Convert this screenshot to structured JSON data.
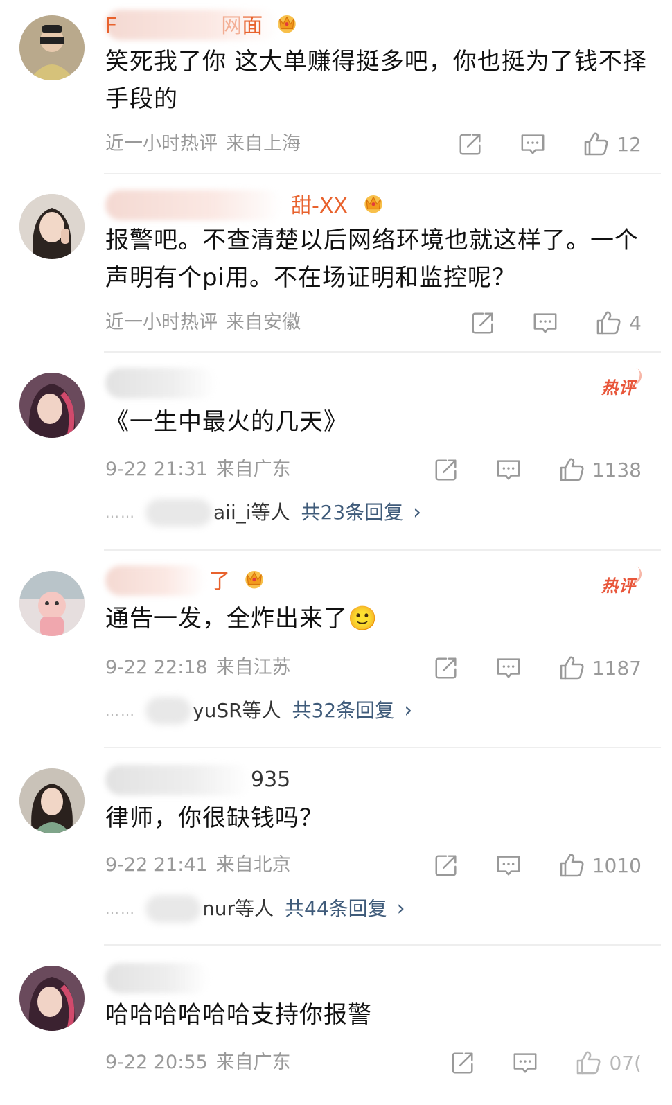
{
  "comments": [
    {
      "name_visible": "面",
      "name_prefix": "F",
      "name_partial": "网",
      "text": "笑死我了你 这大单赚得挺多吧，你也挺为了钱不择手段的",
      "time": "近一小时热评",
      "location": "来自上海",
      "likes": "12",
      "hot": "",
      "crown": true
    },
    {
      "name_visible": "甜-XX",
      "name_prefix": "",
      "text": "报警吧。不查清楚以后网络环境也就这样了。一个声明有个pi用。不在场证明和监控呢？",
      "time": "近一小时热评",
      "location": "来自安徽",
      "likes": "4",
      "hot": "",
      "crown": true
    },
    {
      "name_visible": "",
      "text": "《一生中最火的几天》",
      "time": "9-22 21:31",
      "location": "来自广东",
      "likes": "1138",
      "hot": "热评",
      "replies": {
        "name": "aii_i等人",
        "total": "共23条回复"
      }
    },
    {
      "name_visible": "了",
      "text": "通告一发，全炸出来了🙂",
      "time": "9-22 22:18",
      "location": "来自江苏",
      "likes": "1187",
      "hot": "热评",
      "crown": true,
      "replies": {
        "name": "yuSR等人",
        "total": "共32条回复"
      }
    },
    {
      "name_visible": "935",
      "text": "律师，你很缺钱吗？",
      "time": "9-22 21:41",
      "location": "来自北京",
      "likes": "1010",
      "hot": "",
      "replies": {
        "name": "nur等人",
        "total": "共44条回复"
      }
    },
    {
      "name_visible": "",
      "text": "哈哈哈哈哈哈支持你报警",
      "time": "9-22 20:55",
      "location": "来自广东",
      "likes": "07(",
      "hot": ""
    }
  ],
  "reply_dots": "……",
  "reply_chevron": "›",
  "icons": {
    "share": "share-icon",
    "comment": "comment-icon",
    "like": "thumbs-up-icon",
    "crown": "crown-icon"
  },
  "colors": {
    "name_orange": "#e8622d",
    "link_blue": "#3f5b7a",
    "meta_gray": "#999999",
    "hot_red": "#e8563a"
  }
}
